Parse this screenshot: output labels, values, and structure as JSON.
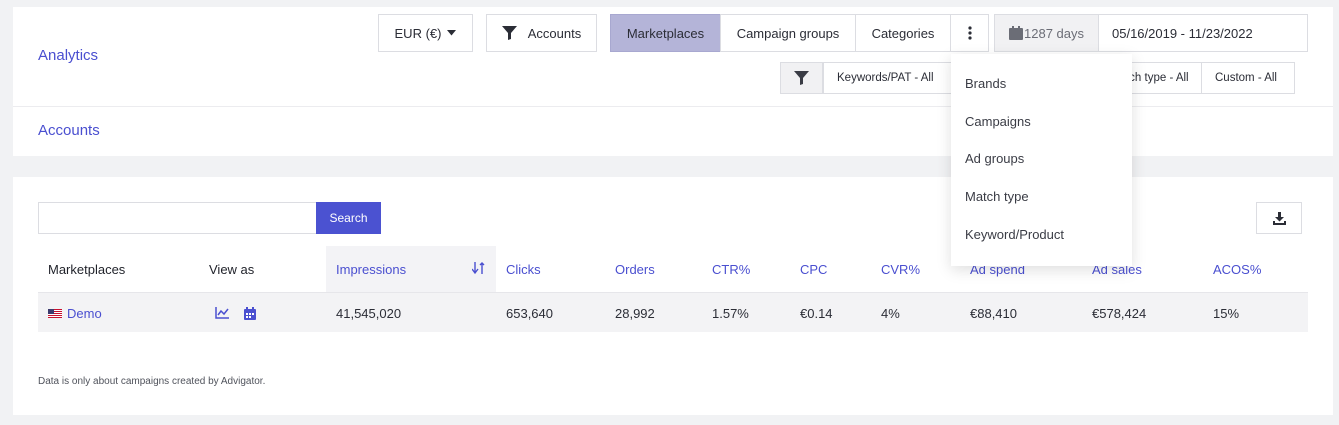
{
  "header": {
    "title": "Analytics",
    "subtitle": "Accounts",
    "currency": "EUR (€)",
    "accounts_label": "Accounts",
    "view_tabs": [
      "Marketplaces",
      "Campaign groups",
      "Categories"
    ],
    "days_label": "1287 days",
    "date_range": "05/16/2019 - 11/23/2022"
  },
  "filters": {
    "keywords": "Keywords/PAT - All",
    "match_type": "Match type - All",
    "custom": "Custom - All"
  },
  "dropdown": {
    "items": [
      "Brands",
      "Campaigns",
      "Ad groups",
      "Match type",
      "Keyword/Product"
    ]
  },
  "search": {
    "value": "",
    "button_label": "Search"
  },
  "table": {
    "headers": [
      "Marketplaces",
      "View as",
      "Impressions",
      "Clicks",
      "Orders",
      "CTR%",
      "CPC",
      "CVR%",
      "Ad spend",
      "Ad sales",
      "ACOS%"
    ],
    "sorted_column": "Impressions",
    "rows": [
      {
        "marketplace": "Demo",
        "impressions": "41,545,020",
        "clicks": "653,640",
        "orders": "28,992",
        "ctr": "1.57%",
        "cpc": "€0.14",
        "cvr": "4%",
        "ad_spend": "€88,410",
        "ad_sales": "€578,424",
        "acos": "15%"
      }
    ]
  },
  "footnote": "Data is only about campaigns created by Advigator.",
  "colors": {
    "accent": "#4b52d1",
    "link": "#4a4fd0",
    "active_tab": "#b4b4d8"
  }
}
